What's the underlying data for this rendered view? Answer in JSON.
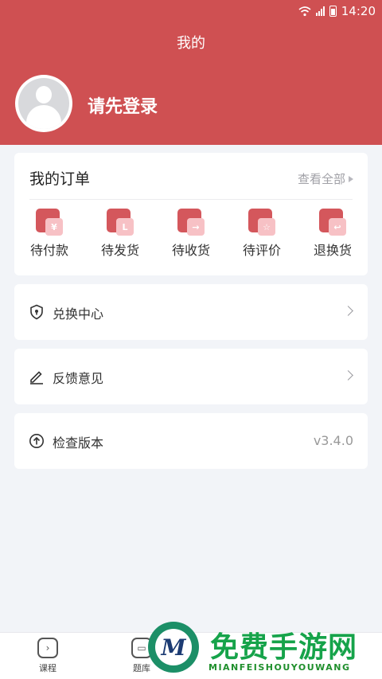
{
  "status_bar": {
    "time": "14:20"
  },
  "header": {
    "title": "我的",
    "login_prompt": "请先登录"
  },
  "orders": {
    "title": "我的订单",
    "view_all": "查看全部",
    "items": [
      {
        "label": "待付款",
        "icon": "yen-icon",
        "glyph": "¥"
      },
      {
        "label": "待发货",
        "icon": "clock-icon",
        "glyph": "L"
      },
      {
        "label": "待收货",
        "icon": "arrow-right-icon",
        "glyph": "→"
      },
      {
        "label": "待评价",
        "icon": "star-icon",
        "glyph": "☆"
      },
      {
        "label": "退换货",
        "icon": "return-icon",
        "glyph": "↩"
      }
    ]
  },
  "menu": {
    "exchange": {
      "label": "兑换中心",
      "icon": "shield-icon"
    },
    "feedback": {
      "label": "反馈意见",
      "icon": "pencil-icon"
    },
    "version": {
      "label": "检查版本",
      "value": "v3.4.0",
      "icon": "upload-circle-icon"
    }
  },
  "tabbar": {
    "tabs": [
      {
        "label": "课程",
        "icon": "play-icon"
      },
      {
        "label": "题库",
        "icon": "library-icon"
      }
    ]
  },
  "watermark": {
    "logo_letter": "M",
    "cn": "免费手游网",
    "en": "MIANFEISHOUYOUWANG"
  },
  "colors": {
    "accent": "#cf5052",
    "background": "#f2f4f8"
  }
}
